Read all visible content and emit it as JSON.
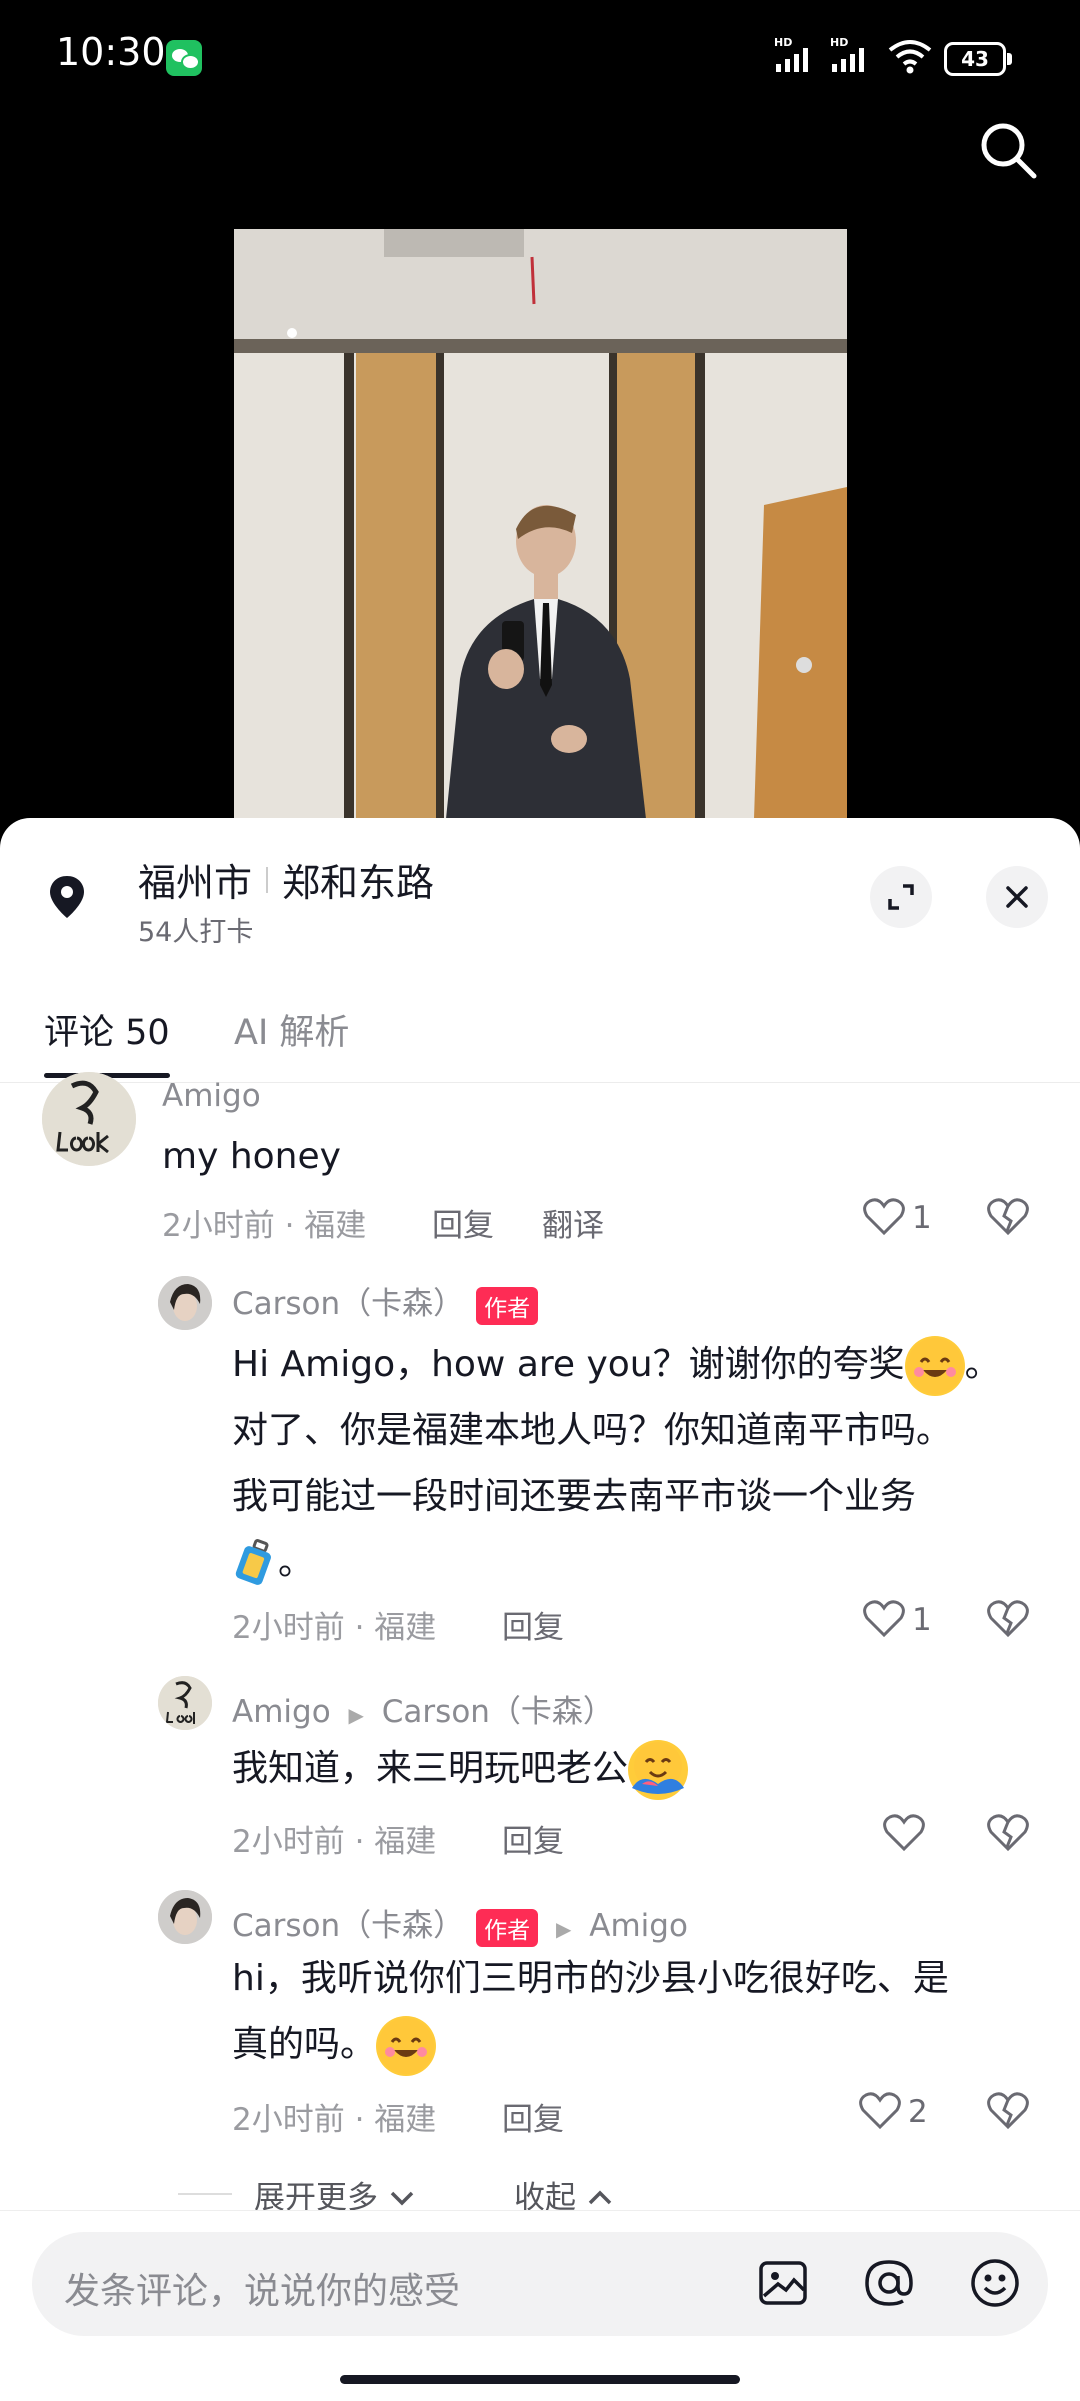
{
  "status_bar": {
    "time": "10:30",
    "hd1": "HD",
    "hd2": "HD",
    "battery": "43"
  },
  "location": {
    "city": "福州市",
    "road": "郑和东路",
    "checkins": "54人打卡"
  },
  "tabs": {
    "comments": "评论 50",
    "ai": "AI 解析"
  },
  "comments": [
    {
      "user": "Amigo",
      "text": "my honey",
      "time": "2小时前 · 福建",
      "reply": "回复",
      "translate": "翻译",
      "likes": "1"
    },
    {
      "user": "Carson（卡森）",
      "badge": "作者",
      "lines": [
        "Hi Amigo，how are you？谢谢你的夸奖",
        "对了、你是福建本地人吗？你知道南平市吗。",
        "我可能过一段时间还要去南平市谈一个业务",
        "。"
      ],
      "line1_end": "。",
      "time": "2小时前 · 福建",
      "reply": "回复",
      "likes": "1"
    },
    {
      "user": "Amigo",
      "reply_to": "Carson（卡森）",
      "text": "我知道，来三明玩吧老公",
      "time": "2小时前 · 福建",
      "reply": "回复"
    },
    {
      "user": "Carson（卡森）",
      "badge": "作者",
      "reply_to": "Amigo",
      "lines": [
        "hi，我听说你们三明市的沙县小吃很好吃、是",
        "真的吗。"
      ],
      "time": "2小时前 · 福建",
      "reply": "回复",
      "likes": "2"
    }
  ],
  "expand": {
    "more": "展开更多",
    "collapse": "收起"
  },
  "input": {
    "placeholder": "发条评论，说说你的感受"
  }
}
